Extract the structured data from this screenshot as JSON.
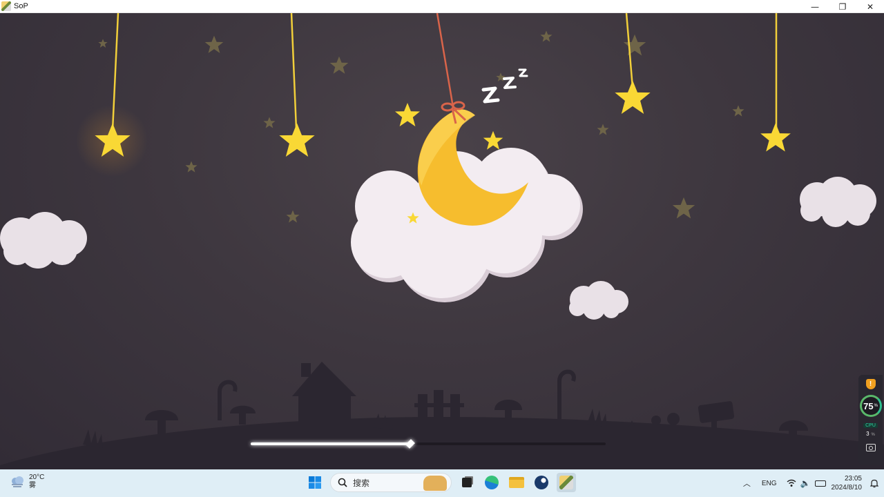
{
  "window": {
    "title": "SoP",
    "icons": {
      "app": "app-icon",
      "minimize": "minimize-icon",
      "maximize": "restore-icon",
      "close": "close-icon"
    }
  },
  "scene": {
    "snore": "Z z z",
    "icons": [
      "moon-icon",
      "cloud-icon",
      "star-icon",
      "house-icon",
      "mushroom-icon",
      "signpost-icon"
    ],
    "colors": {
      "sky": "#3e373f",
      "ground": "#2b2630",
      "star": "#f9d835",
      "moon": "#f6bd2e",
      "cloud": "#f1e8ee"
    }
  },
  "player": {
    "progress_fraction": 0.45
  },
  "side_widget": {
    "gauge_value": "75",
    "gauge_unit": "%",
    "cpu_label": "CPU",
    "cpu_value": "3",
    "cpu_unit": "%"
  },
  "taskbar": {
    "weather": {
      "temp": "20°C",
      "condition": "雾",
      "icon": "cloudy-icon"
    },
    "search_placeholder": "搜索",
    "apps": [
      "windows-start-icon",
      "search-icon",
      "task-view-icon",
      "edge-icon",
      "file-explorer-icon",
      "steam-icon",
      "sop-app-icon"
    ],
    "tray": {
      "language": "ENG",
      "time": "23:05",
      "date": "2024/8/10",
      "icons": [
        "chevron-up-icon",
        "wifi-icon",
        "volume-icon",
        "battery-icon",
        "notification-bell-icon"
      ]
    }
  }
}
